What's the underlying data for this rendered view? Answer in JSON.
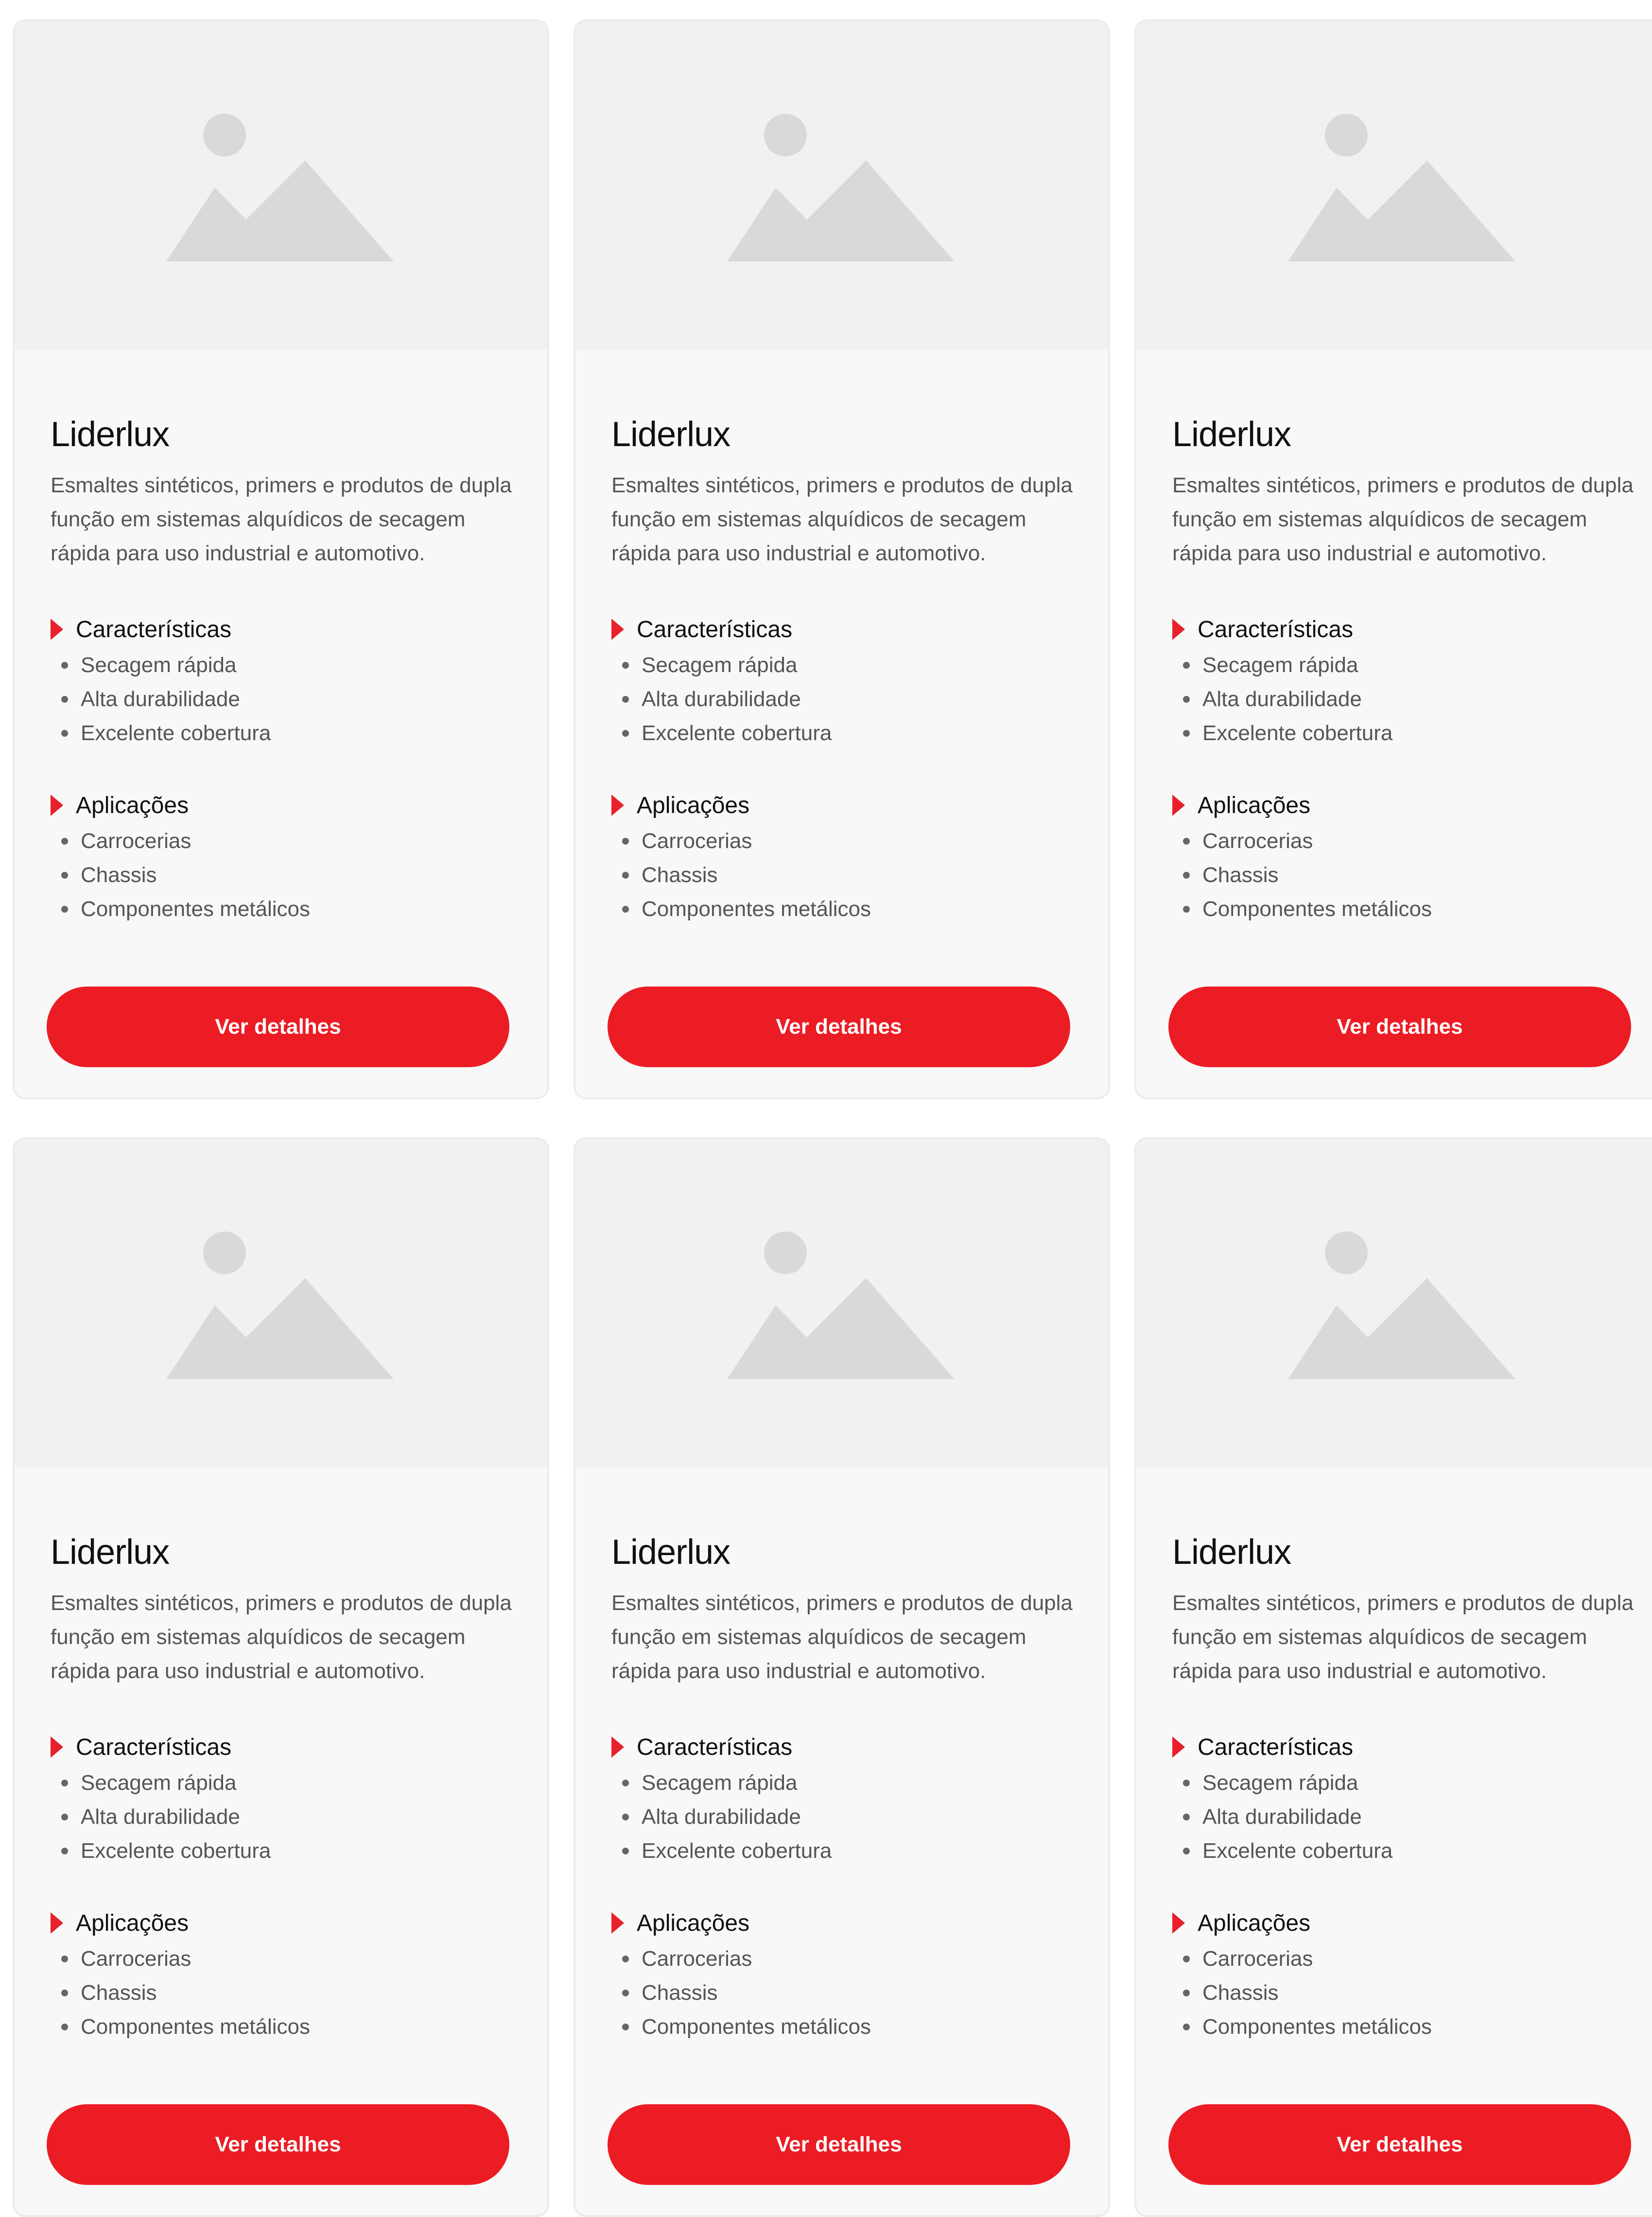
{
  "theme": {
    "accent": "#ec1c24",
    "card_background": "#f8f8f8",
    "image_placeholder_background": "#f1f1f1",
    "placeholder_icon_color": "#d9d9d9"
  },
  "cards": [
    {
      "image_icon": "image-placeholder-icon",
      "title": "Liderlux",
      "description": "Esmaltes sintéticos, primers e produtos de dupla função em sistemas alquídicos de secagem rápida para uso industrial e automotivo.",
      "features_heading": "Características",
      "features": [
        "Secagem rápida",
        "Alta durabilidade",
        "Excelente cobertura"
      ],
      "applications_heading": "Aplicações",
      "applications": [
        "Carrocerias",
        "Chassis",
        "Componentes metálicos"
      ],
      "cta_label": "Ver detalhes"
    },
    {
      "image_icon": "image-placeholder-icon",
      "title": "Liderlux",
      "description": "Esmaltes sintéticos, primers e produtos de dupla função em sistemas alquídicos de secagem rápida para uso industrial e automotivo.",
      "features_heading": "Características",
      "features": [
        "Secagem rápida",
        "Alta durabilidade",
        "Excelente cobertura"
      ],
      "applications_heading": "Aplicações",
      "applications": [
        "Carrocerias",
        "Chassis",
        "Componentes metálicos"
      ],
      "cta_label": "Ver detalhes"
    },
    {
      "image_icon": "image-placeholder-icon",
      "title": "Liderlux",
      "description": "Esmaltes sintéticos, primers e produtos de dupla função em sistemas alquídicos de secagem rápida para uso industrial e automotivo.",
      "features_heading": "Características",
      "features": [
        "Secagem rápida",
        "Alta durabilidade",
        "Excelente cobertura"
      ],
      "applications_heading": "Aplicações",
      "applications": [
        "Carrocerias",
        "Chassis",
        "Componentes metálicos"
      ],
      "cta_label": "Ver detalhes"
    },
    {
      "image_icon": "image-placeholder-icon",
      "title": "Liderlux",
      "description": "Esmaltes sintéticos, primers e produtos de dupla função em sistemas alquídicos de secagem rápida para uso industrial e automotivo.",
      "features_heading": "Características",
      "features": [
        "Secagem rápida",
        "Alta durabilidade",
        "Excelente cobertura"
      ],
      "applications_heading": "Aplicações",
      "applications": [
        "Carrocerias",
        "Chassis",
        "Componentes metálicos"
      ],
      "cta_label": "Ver detalhes"
    },
    {
      "image_icon": "image-placeholder-icon",
      "title": "Liderlux",
      "description": "Esmaltes sintéticos, primers e produtos de dupla função em sistemas alquídicos de secagem rápida para uso industrial e automotivo.",
      "features_heading": "Características",
      "features": [
        "Secagem rápida",
        "Alta durabilidade",
        "Excelente cobertura"
      ],
      "applications_heading": "Aplicações",
      "applications": [
        "Carrocerias",
        "Chassis",
        "Componentes metálicos"
      ],
      "cta_label": "Ver detalhes"
    },
    {
      "image_icon": "image-placeholder-icon",
      "title": "Liderlux",
      "description": "Esmaltes sintéticos, primers e produtos de dupla função em sistemas alquídicos de secagem rápida para uso industrial e automotivo.",
      "features_heading": "Características",
      "features": [
        "Secagem rápida",
        "Alta durabilidade",
        "Excelente cobertura"
      ],
      "applications_heading": "Aplicações",
      "applications": [
        "Carrocerias",
        "Chassis",
        "Componentes metálicos"
      ],
      "cta_label": "Ver detalhes"
    }
  ]
}
